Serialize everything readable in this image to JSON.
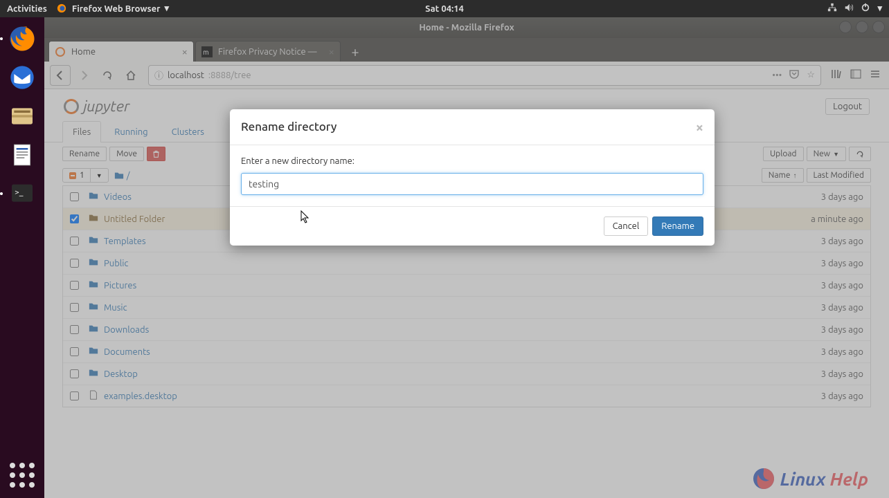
{
  "topbar": {
    "activities": "Activities",
    "app_name": "Firefox Web Browser",
    "clock": "Sat 04:14"
  },
  "window": {
    "title": "Home - Mozilla Firefox"
  },
  "tabs": [
    {
      "label": "Home",
      "active": true
    },
    {
      "label": "Firefox Privacy Notice —",
      "active": false
    }
  ],
  "url": {
    "host": "localhost",
    "path": ":8888/tree"
  },
  "jupyter": {
    "brand": "jupyter",
    "logout": "Logout",
    "tabs": {
      "files": "Files",
      "running": "Running",
      "clusters": "Clusters"
    },
    "actions": {
      "rename": "Rename",
      "move": "Move"
    },
    "right_actions": {
      "upload": "Upload",
      "new": "New"
    },
    "select_count": "1",
    "sort": {
      "name": "Name",
      "modified": "Last Modified"
    },
    "items": [
      {
        "name": "Videos",
        "type": "folder",
        "modified": "3 days ago",
        "checked": false
      },
      {
        "name": "Untitled Folder",
        "type": "folder",
        "modified": "a minute ago",
        "checked": true
      },
      {
        "name": "Templates",
        "type": "folder",
        "modified": "3 days ago",
        "checked": false
      },
      {
        "name": "Public",
        "type": "folder",
        "modified": "3 days ago",
        "checked": false
      },
      {
        "name": "Pictures",
        "type": "folder",
        "modified": "3 days ago",
        "checked": false
      },
      {
        "name": "Music",
        "type": "folder",
        "modified": "3 days ago",
        "checked": false
      },
      {
        "name": "Downloads",
        "type": "folder",
        "modified": "3 days ago",
        "checked": false
      },
      {
        "name": "Documents",
        "type": "folder",
        "modified": "3 days ago",
        "checked": false
      },
      {
        "name": "Desktop",
        "type": "folder",
        "modified": "3 days ago",
        "checked": false
      },
      {
        "name": "examples.desktop",
        "type": "file",
        "modified": "3 days ago",
        "checked": false
      }
    ]
  },
  "modal": {
    "title": "Rename directory",
    "prompt": "Enter a new directory name:",
    "value": "testing",
    "cancel": "Cancel",
    "rename": "Rename"
  },
  "watermark": {
    "t1": "Linux",
    "t2": "Help"
  }
}
